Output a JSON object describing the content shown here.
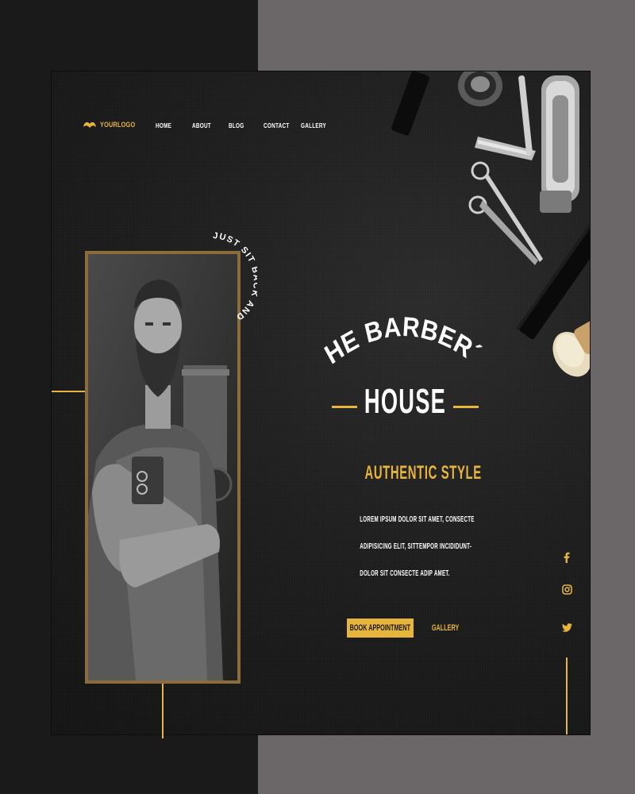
{
  "nav": {
    "logo_text": "YOURLOGO",
    "items": [
      {
        "label": "HOME"
      },
      {
        "label": "ABOUT"
      },
      {
        "label": "BLOG"
      },
      {
        "label": "CONTACT"
      },
      {
        "label": "GALLERY"
      }
    ]
  },
  "badge": {
    "text": "JUST SIT BACK AND ENJOY."
  },
  "hero": {
    "title_line1": "THE BARBER´S",
    "title_line2": "HOUSE",
    "subtitle": "AUTHENTIC STYLE",
    "body_lines": [
      "LOREM IPSUM DOLOR SIT AMET, CONSECTE",
      "ADIPISICING ELIT, SITTEMPOR INCIDIDUNT-",
      "DOLOR SIT CONSECTE ADIP AMET."
    ],
    "primary_button": "BOOK APPOINTMENT",
    "secondary_button": "GALLERY"
  },
  "social": [
    {
      "icon": "facebook-icon"
    },
    {
      "icon": "instagram-icon"
    },
    {
      "icon": "twitter-icon"
    }
  ],
  "colors": {
    "accent": "#e7b43c",
    "frame": "#8a6d3b",
    "background": "#1e1e1e",
    "side_panel": "#6b6768"
  }
}
